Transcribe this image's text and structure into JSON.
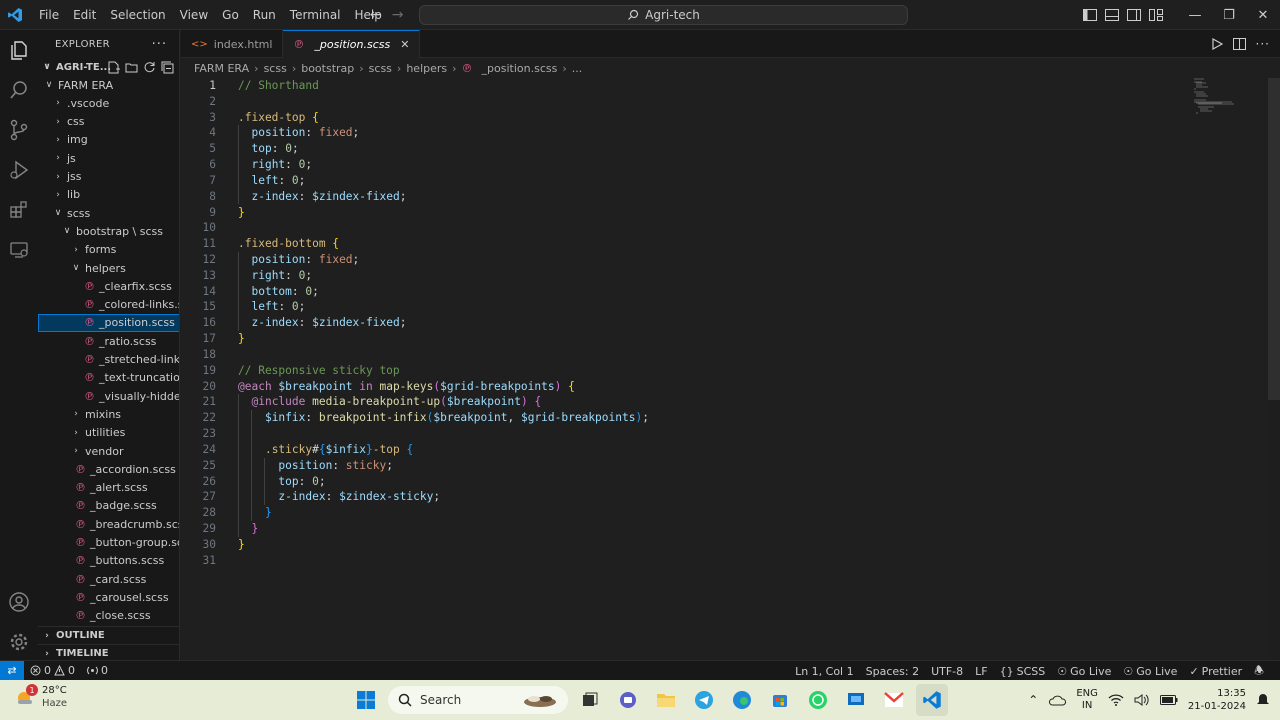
{
  "titlebar": {
    "menu": [
      "File",
      "Edit",
      "Selection",
      "View",
      "Go",
      "Run",
      "Terminal",
      "Help"
    ],
    "search": "Agri-tech"
  },
  "sidebar": {
    "title": "EXPLORER",
    "root": "AGRI-TE...",
    "tree": [
      {
        "label": "FARM ERA",
        "depth": 1,
        "type": "folder-open"
      },
      {
        "label": ".vscode",
        "depth": 2,
        "type": "folder"
      },
      {
        "label": "css",
        "depth": 2,
        "type": "folder"
      },
      {
        "label": "img",
        "depth": 2,
        "type": "folder"
      },
      {
        "label": "js",
        "depth": 2,
        "type": "folder"
      },
      {
        "label": "jss",
        "depth": 2,
        "type": "folder"
      },
      {
        "label": "lib",
        "depth": 2,
        "type": "folder"
      },
      {
        "label": "scss",
        "depth": 2,
        "type": "folder-open"
      },
      {
        "label": "bootstrap \\ scss",
        "depth": 3,
        "type": "folder-open"
      },
      {
        "label": "forms",
        "depth": 4,
        "type": "folder"
      },
      {
        "label": "helpers",
        "depth": 4,
        "type": "folder-open"
      },
      {
        "label": "_clearfix.scss",
        "depth": 5,
        "type": "file"
      },
      {
        "label": "_colored-links.s...",
        "depth": 5,
        "type": "file"
      },
      {
        "label": "_position.scss",
        "depth": 5,
        "type": "file",
        "selected": true
      },
      {
        "label": "_ratio.scss",
        "depth": 5,
        "type": "file"
      },
      {
        "label": "_stretched-link.s...",
        "depth": 5,
        "type": "file"
      },
      {
        "label": "_text-truncation...",
        "depth": 5,
        "type": "file"
      },
      {
        "label": "_visually-hidden...",
        "depth": 5,
        "type": "file"
      },
      {
        "label": "mixins",
        "depth": 4,
        "type": "folder"
      },
      {
        "label": "utilities",
        "depth": 4,
        "type": "folder"
      },
      {
        "label": "vendor",
        "depth": 4,
        "type": "folder"
      },
      {
        "label": "_accordion.scss",
        "depth": 4,
        "type": "file"
      },
      {
        "label": "_alert.scss",
        "depth": 4,
        "type": "file"
      },
      {
        "label": "_badge.scss",
        "depth": 4,
        "type": "file"
      },
      {
        "label": "_breadcrumb.scss",
        "depth": 4,
        "type": "file"
      },
      {
        "label": "_button-group.scss",
        "depth": 4,
        "type": "file"
      },
      {
        "label": "_buttons.scss",
        "depth": 4,
        "type": "file"
      },
      {
        "label": "_card.scss",
        "depth": 4,
        "type": "file"
      },
      {
        "label": "_carousel.scss",
        "depth": 4,
        "type": "file"
      },
      {
        "label": "_close.scss",
        "depth": 4,
        "type": "file"
      }
    ],
    "outline": "OUTLINE",
    "timeline": "TIMELINE"
  },
  "tabs": [
    {
      "label": "index.html",
      "icon": "html-icon",
      "active": false
    },
    {
      "label": "_position.scss",
      "icon": "scss-icon",
      "active": true
    }
  ],
  "breadcrumb": [
    "FARM ERA",
    "scss",
    "bootstrap",
    "scss",
    "helpers",
    "_position.scss",
    "..."
  ],
  "code": [
    [
      [
        "c-com",
        "// Shorthand"
      ]
    ],
    [],
    [
      [
        "c-sel",
        ".fixed-top "
      ],
      [
        "c-br1",
        "{"
      ]
    ],
    [
      [
        "c-pn",
        "  "
      ],
      [
        "c-prop",
        "position"
      ],
      [
        "c-pn",
        ": "
      ],
      [
        "c-val",
        "fixed"
      ],
      [
        "c-pn",
        ";"
      ]
    ],
    [
      [
        "c-pn",
        "  "
      ],
      [
        "c-prop",
        "top"
      ],
      [
        "c-pn",
        ": "
      ],
      [
        "c-num",
        "0"
      ],
      [
        "c-pn",
        ";"
      ]
    ],
    [
      [
        "c-pn",
        "  "
      ],
      [
        "c-prop",
        "right"
      ],
      [
        "c-pn",
        ": "
      ],
      [
        "c-num",
        "0"
      ],
      [
        "c-pn",
        ";"
      ]
    ],
    [
      [
        "c-pn",
        "  "
      ],
      [
        "c-prop",
        "left"
      ],
      [
        "c-pn",
        ": "
      ],
      [
        "c-num",
        "0"
      ],
      [
        "c-pn",
        ";"
      ]
    ],
    [
      [
        "c-pn",
        "  "
      ],
      [
        "c-prop",
        "z-index"
      ],
      [
        "c-pn",
        ": "
      ],
      [
        "c-var",
        "$zindex-fixed"
      ],
      [
        "c-pn",
        ";"
      ]
    ],
    [
      [
        "c-br1",
        "}"
      ]
    ],
    [],
    [
      [
        "c-sel",
        ".fixed-bottom "
      ],
      [
        "c-br1",
        "{"
      ]
    ],
    [
      [
        "c-pn",
        "  "
      ],
      [
        "c-prop",
        "position"
      ],
      [
        "c-pn",
        ": "
      ],
      [
        "c-val",
        "fixed"
      ],
      [
        "c-pn",
        ";"
      ]
    ],
    [
      [
        "c-pn",
        "  "
      ],
      [
        "c-prop",
        "right"
      ],
      [
        "c-pn",
        ": "
      ],
      [
        "c-num",
        "0"
      ],
      [
        "c-pn",
        ";"
      ]
    ],
    [
      [
        "c-pn",
        "  "
      ],
      [
        "c-prop",
        "bottom"
      ],
      [
        "c-pn",
        ": "
      ],
      [
        "c-num",
        "0"
      ],
      [
        "c-pn",
        ";"
      ]
    ],
    [
      [
        "c-pn",
        "  "
      ],
      [
        "c-prop",
        "left"
      ],
      [
        "c-pn",
        ": "
      ],
      [
        "c-num",
        "0"
      ],
      [
        "c-pn",
        ";"
      ]
    ],
    [
      [
        "c-pn",
        "  "
      ],
      [
        "c-prop",
        "z-index"
      ],
      [
        "c-pn",
        ": "
      ],
      [
        "c-var",
        "$zindex-fixed"
      ],
      [
        "c-pn",
        ";"
      ]
    ],
    [
      [
        "c-br1",
        "}"
      ]
    ],
    [],
    [
      [
        "c-com",
        "// Responsive sticky top"
      ]
    ],
    [
      [
        "c-at",
        "@each "
      ],
      [
        "c-var",
        "$breakpoint "
      ],
      [
        "c-at",
        "in "
      ],
      [
        "c-fn",
        "map-keys"
      ],
      [
        "c-br2",
        "("
      ],
      [
        "c-var",
        "$grid-breakpoints"
      ],
      [
        "c-br2",
        ")"
      ],
      [
        "c-pn",
        " "
      ],
      [
        "c-br1",
        "{"
      ]
    ],
    [
      [
        "c-pn",
        "  "
      ],
      [
        "c-at",
        "@include "
      ],
      [
        "c-fn",
        "media-breakpoint-up"
      ],
      [
        "c-br2",
        "("
      ],
      [
        "c-var",
        "$breakpoint"
      ],
      [
        "c-br2",
        ")"
      ],
      [
        "c-pn",
        " "
      ],
      [
        "c-br2",
        "{"
      ]
    ],
    [
      [
        "c-pn",
        "    "
      ],
      [
        "c-var",
        "$infix"
      ],
      [
        "c-pn",
        ": "
      ],
      [
        "c-fn",
        "breakpoint-infix"
      ],
      [
        "c-br3",
        "("
      ],
      [
        "c-var",
        "$breakpoint"
      ],
      [
        "c-pn",
        ", "
      ],
      [
        "c-var",
        "$grid-breakpoints"
      ],
      [
        "c-br3",
        ")"
      ],
      [
        "c-pn",
        ";"
      ]
    ],
    [],
    [
      [
        "c-pn",
        "    "
      ],
      [
        "c-sel",
        ".sticky"
      ],
      [
        "c-pn",
        "#"
      ],
      [
        "c-br3",
        "{"
      ],
      [
        "c-var",
        "$infix"
      ],
      [
        "c-br3",
        "}"
      ],
      [
        "c-sel",
        "-top "
      ],
      [
        "c-br3",
        "{"
      ]
    ],
    [
      [
        "c-pn",
        "      "
      ],
      [
        "c-prop",
        "position"
      ],
      [
        "c-pn",
        ": "
      ],
      [
        "c-val",
        "sticky"
      ],
      [
        "c-pn",
        ";"
      ]
    ],
    [
      [
        "c-pn",
        "      "
      ],
      [
        "c-prop",
        "top"
      ],
      [
        "c-pn",
        ": "
      ],
      [
        "c-num",
        "0"
      ],
      [
        "c-pn",
        ";"
      ]
    ],
    [
      [
        "c-pn",
        "      "
      ],
      [
        "c-prop",
        "z-index"
      ],
      [
        "c-pn",
        ": "
      ],
      [
        "c-var",
        "$zindex-sticky"
      ],
      [
        "c-pn",
        ";"
      ]
    ],
    [
      [
        "c-pn",
        "    "
      ],
      [
        "c-br3",
        "}"
      ]
    ],
    [
      [
        "c-pn",
        "  "
      ],
      [
        "c-br2",
        "}"
      ]
    ],
    [
      [
        "c-br1",
        "}"
      ]
    ],
    []
  ],
  "cursor_line": 1,
  "statusbar": {
    "errors": "0",
    "warnings": "0",
    "ports": "0",
    "position": "Ln 1, Col 1",
    "spaces": "Spaces: 2",
    "encoding": "UTF-8",
    "eol": "LF",
    "language": "SCSS",
    "golive1": "Go Live",
    "golive2": "Go Live",
    "prettier": "Prettier"
  },
  "taskbar": {
    "temp": "28°C",
    "weather": "Haze",
    "weather_badge": "1",
    "search": "Search",
    "lang1": "ENG",
    "lang2": "IN",
    "time": "13:35",
    "date": "21-01-2024"
  },
  "colors": {
    "accent": "#0078d4",
    "scss": "#e05a8b",
    "taskbar_bg": "#e6ecd6"
  }
}
